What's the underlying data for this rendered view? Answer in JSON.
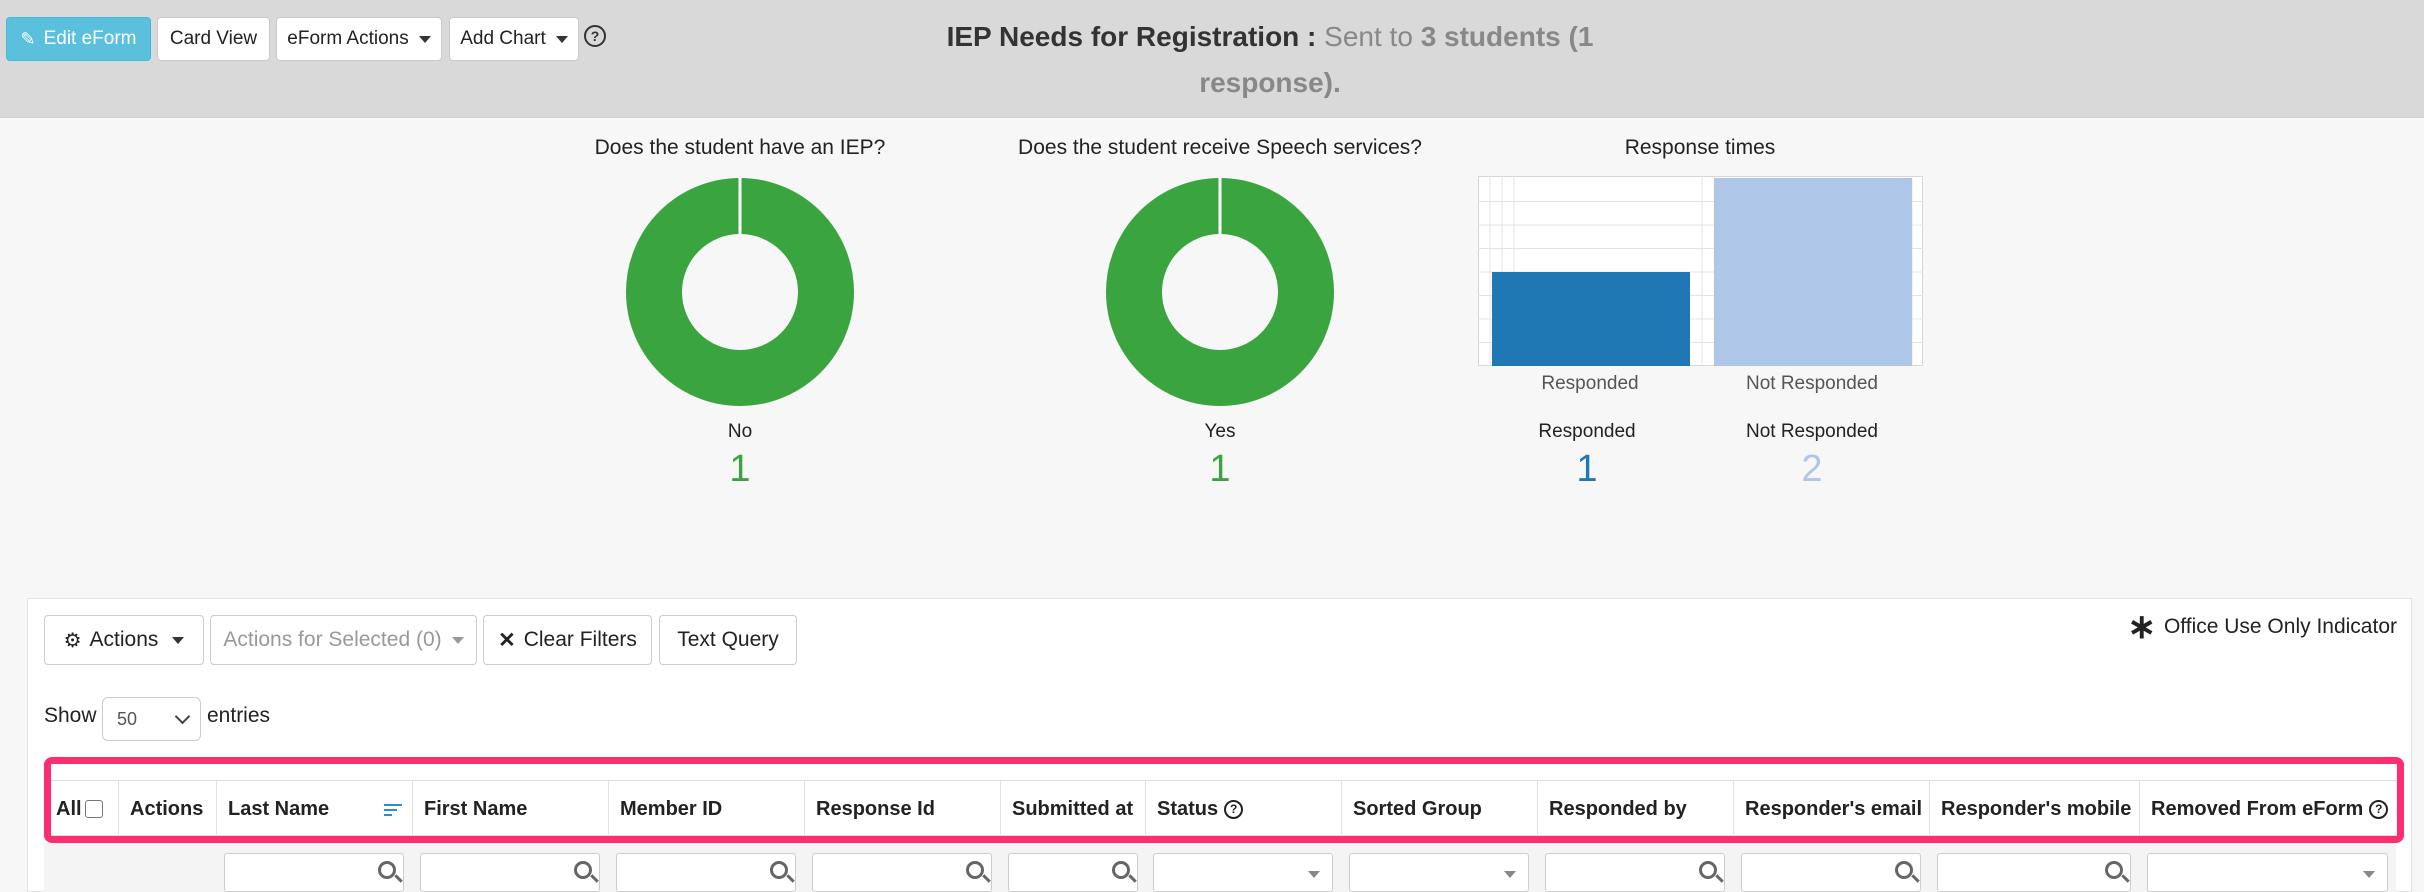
{
  "toolbar": {
    "edit_label": "Edit eForm",
    "card_view_label": "Card View",
    "eform_actions_label": "eForm Actions",
    "add_chart_label": "Add Chart",
    "help_glyph": "?"
  },
  "header": {
    "form_name": "IEP Needs for Registration",
    "separator": " : ",
    "sent_to": "Sent to ",
    "count_text": "3 students (1",
    "response_text": "response)."
  },
  "charts": [
    {
      "title": "Does the student have an IEP?",
      "type": "donut",
      "label": "No",
      "value": "1",
      "color": "#3aa53f"
    },
    {
      "title": "Does the student receive Speech services?",
      "type": "donut",
      "label": "Yes",
      "value": "1",
      "color": "#3aa53f"
    },
    {
      "title": "Response times",
      "type": "bar",
      "categories": [
        "Responded",
        "Not Responded"
      ],
      "legend": [
        {
          "label": "Responded",
          "value": "1",
          "color": "#1f77b4"
        },
        {
          "label": "Not Responded",
          "value": "2",
          "color": "#aec7e8"
        }
      ]
    }
  ],
  "chart_data": [
    {
      "type": "pie",
      "title": "Does the student have an IEP?",
      "labels": [
        "No"
      ],
      "values": [
        1
      ],
      "colors": [
        "#3aa53f"
      ]
    },
    {
      "type": "pie",
      "title": "Does the student receive Speech services?",
      "labels": [
        "Yes"
      ],
      "values": [
        1
      ],
      "colors": [
        "#3aa53f"
      ]
    },
    {
      "type": "bar",
      "title": "Response times",
      "categories": [
        "Responded",
        "Not Responded"
      ],
      "values": [
        1,
        2
      ],
      "colors": [
        "#1f77b4",
        "#aec7e8"
      ],
      "ylim": [
        0,
        2
      ],
      "grid": true
    }
  ],
  "table_toolbar": {
    "actions_label": "Actions",
    "selected_label": "Actions for Selected (0)",
    "clear_filters_label": "Clear Filters",
    "text_query_label": "Text Query",
    "office_indicator": "Office Use Only Indicator",
    "office_star": "∗"
  },
  "length": {
    "show_label": "Show",
    "value": "50",
    "entries_label": "entries"
  },
  "columns": [
    "All",
    "Actions",
    "Last Name",
    "First Name",
    "Member ID",
    "Response Id",
    "Submitted at",
    "Status",
    "Sorted Group",
    "Responded by",
    "Responder's email",
    "Responder's mobile",
    "Removed From eForm"
  ],
  "colors": {
    "header_bg": "#d9d9d9",
    "primary": "#5bc0de",
    "highlight": "#ff2d6f",
    "sort_icon": "#2a8dd6"
  }
}
